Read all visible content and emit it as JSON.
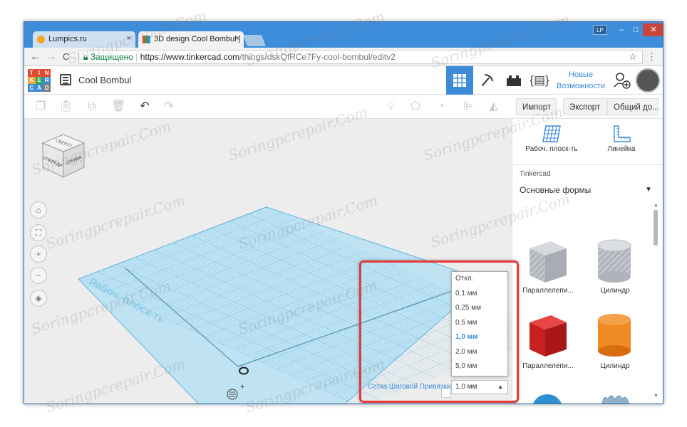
{
  "browser": {
    "tabs": [
      {
        "label": "Lumpics.ru",
        "close": "×"
      },
      {
        "label": "3D design Cool Bombul |",
        "close": "×"
      }
    ],
    "window_badge": "LP",
    "window_controls": {
      "minimize": "–",
      "maximize": "□",
      "close": "✕"
    },
    "nav": {
      "back": "←",
      "forward": "→",
      "reload": "C"
    },
    "address": {
      "secure_label": "Защищено",
      "scheme_host": "https://www.tinkercad.com",
      "path": "/things/dskQfRCe7Fy-cool-bombul/editv2"
    },
    "star": "☆",
    "menu": "⋮"
  },
  "app": {
    "logo_letters": [
      "T",
      "I",
      "N",
      "K",
      "E",
      "R",
      "C",
      "A",
      "D"
    ],
    "logo_colors": [
      "#e2492f",
      "#e2492f",
      "#e2492f",
      "#f2a436",
      "#2da44e",
      "#3c8bd9",
      "#3c8bd9",
      "#3c8bd9",
      "#7a7a7a"
    ],
    "design_title": "Cool Bombul",
    "new_features_line1": "Новые",
    "new_features_line2": "Возможности",
    "accent_color": "#3c8bd9"
  },
  "toolbar": {
    "import_label": "Импорт",
    "export_label": "Экспорт",
    "share_label": "Общий до..."
  },
  "view_cube": {
    "top_face": "СВЕРХУ",
    "front_face": "СПЕРЕДИ",
    "right_face": "СПРАВА"
  },
  "workplane": {
    "label": "Рабоч. плоск-ть"
  },
  "right_panel": {
    "workplane_button": "Рабоч. плоск-ть",
    "ruler_button": "Линейка",
    "library_label": "Tinkercad",
    "library_value": "Основные формы",
    "shapes": [
      {
        "label": "Параллелепи...",
        "color": "#b9bdc4"
      },
      {
        "label": "Цилиндр",
        "color": "#b9bdc4"
      },
      {
        "label": "Параллелепи...",
        "color": "#d62b2b"
      },
      {
        "label": "Цилиндр",
        "color": "#f07a1a"
      },
      {
        "label": "",
        "color": "#2f8fd0"
      },
      {
        "label": "",
        "color": "#8fb3c9"
      }
    ]
  },
  "snap_grid": {
    "label": "Сетка Шаговой Привязки",
    "value": "1,0 мм",
    "options": [
      "Откл.",
      "0,1 мм",
      "0,25 мм",
      "0,5 мм",
      "1,0 мм",
      "2,0 мм",
      "5,0 мм"
    ],
    "selected_index": 4
  },
  "watermark": "Soringpcrepair.Com"
}
